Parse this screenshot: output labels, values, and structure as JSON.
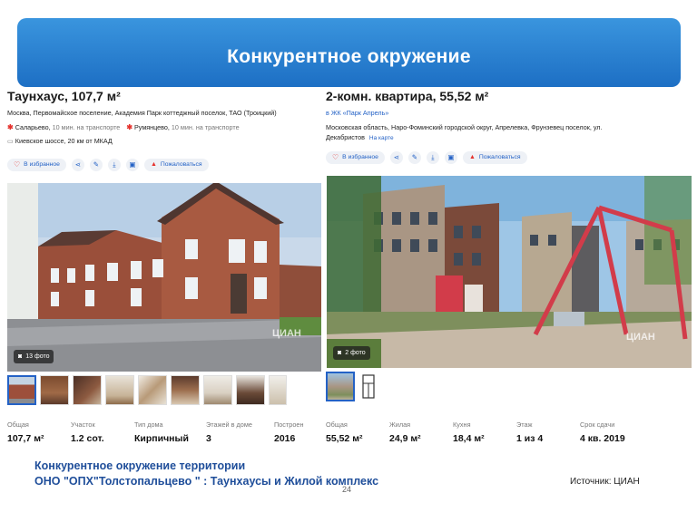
{
  "banner": {
    "title": "Конкурентное окружение"
  },
  "left": {
    "title": "Таунхаус, 107,7 м²",
    "address": "Москва, Первомайское поселение, Академия Парк коттеджный поселок, ТАО (Троицкий)",
    "stations": [
      {
        "name": "Саларьево",
        "time": "10 мин. на транспорте"
      },
      {
        "name": "Румянцево",
        "time": "10 мин. на транспорте"
      }
    ],
    "highway": "Киевское шоссе, 20 км от МКАД",
    "actions": {
      "favorite": "В избранное",
      "report": "Пожаловаться"
    },
    "photo_count": "13 фото",
    "watermark": "ЦИАН",
    "stats": [
      {
        "label": "Общая",
        "value": "107,7 м²"
      },
      {
        "label": "Участок",
        "value": "1.2 сот."
      },
      {
        "label": "Тип дома",
        "value": "Кирпичный"
      },
      {
        "label": "Этажей в доме",
        "value": "3"
      },
      {
        "label": "Построен",
        "value": "2016"
      }
    ]
  },
  "right": {
    "title": "2-комн. квартира, 55,52 м²",
    "complex": "в ЖК «Парк Апрель»",
    "address_line1": "Московская область, Наро-Фоминский городской округ, Апрелевка, Фрунзевец поселок, ул.",
    "address_line2": "Декабристов",
    "map_link": "На карте",
    "actions": {
      "favorite": "В избранное",
      "report": "Пожаловаться"
    },
    "photo_count": "2 фото",
    "watermark": "ЦИАН",
    "stats": [
      {
        "label": "Общая",
        "value": "55,52 м²"
      },
      {
        "label": "Жилая",
        "value": "24,9 м²"
      },
      {
        "label": "Кухня",
        "value": "18,4 м²"
      },
      {
        "label": "Этаж",
        "value": "1 из 4"
      },
      {
        "label": "Срок сдачи",
        "value": "4 кв. 2019"
      }
    ]
  },
  "caption": {
    "line1": "Конкурентное окружение территории",
    "line2": "ОНО \"ОПХ\"Толстопальцево \" : Таунхаусы и Жилой комплекс"
  },
  "source": "Источник: ЦИАН",
  "page_number": "24",
  "colors": {
    "banner": "#2a82d4",
    "link": "#2462c6",
    "metro": "#e5322d",
    "caption": "#1f4e9a"
  }
}
